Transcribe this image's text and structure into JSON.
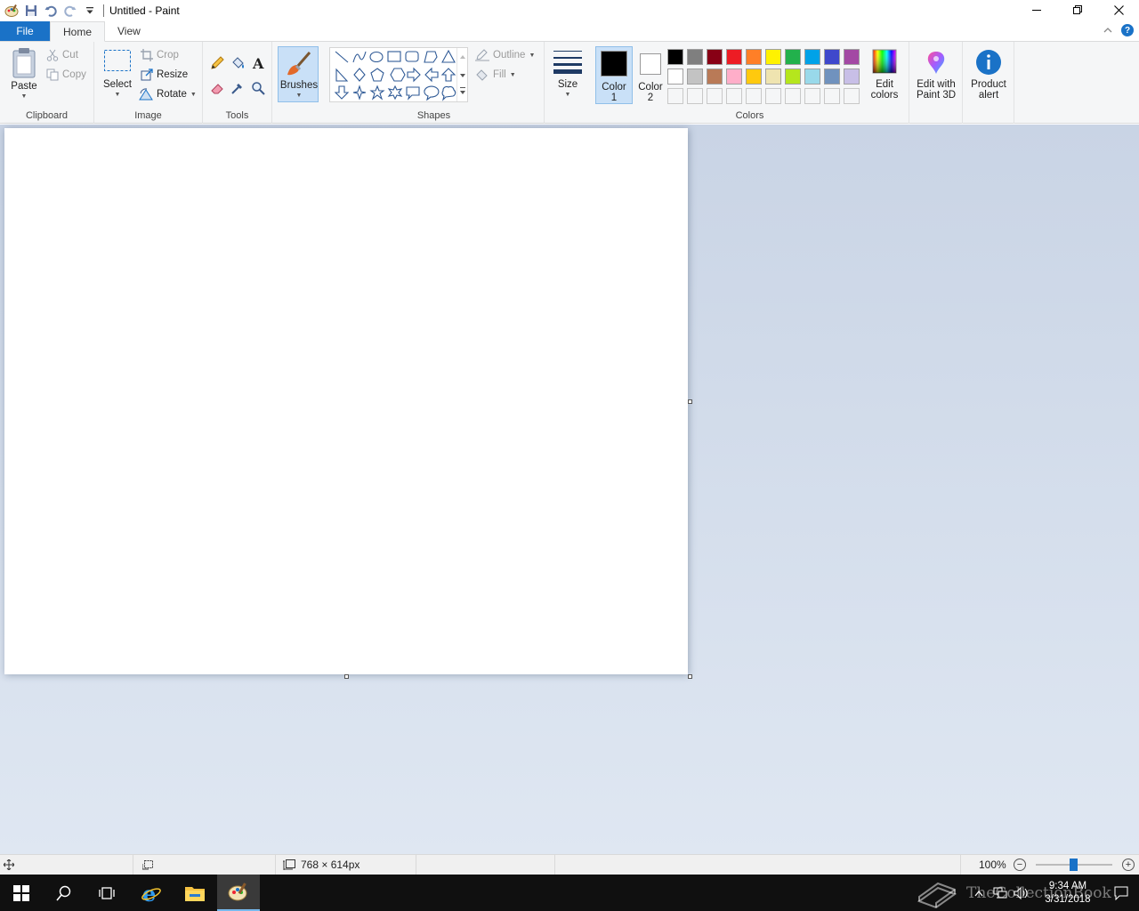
{
  "window": {
    "title": "Untitled - Paint",
    "qat_dropdown_icon": "customize-quick-access-icon"
  },
  "tabs": {
    "file": "File",
    "home": "Home",
    "view": "View",
    "help": "?"
  },
  "clipboard": {
    "label": "Clipboard",
    "paste": "Paste",
    "cut": "Cut",
    "copy": "Copy"
  },
  "image": {
    "label": "Image",
    "select": "Select",
    "crop": "Crop",
    "resize": "Resize",
    "rotate": "Rotate"
  },
  "tools": {
    "label": "Tools",
    "items": [
      "pencil-icon",
      "fill-bucket-icon",
      "text-icon",
      "eraser-icon",
      "color-picker-icon",
      "magnifier-icon"
    ]
  },
  "brushes": {
    "label": "Brushes"
  },
  "shapes": {
    "label": "Shapes",
    "outline": "Outline",
    "fill": "Fill"
  },
  "size": {
    "label": "Size"
  },
  "colors": {
    "label": "Colors",
    "color1_line1": "Color",
    "color1_line2": "1",
    "color2_line1": "Color",
    "color2_line2": "2",
    "color1_value": "#000000",
    "color2_value": "#ffffff",
    "edit_line1": "Edit",
    "edit_line2": "colors",
    "palette_row1": [
      "#000000",
      "#7f7f7f",
      "#880015",
      "#ed1c24",
      "#ff7f27",
      "#fff200",
      "#22b14c",
      "#00a2e8",
      "#3f48cc",
      "#a349a4"
    ],
    "palette_row2": [
      "#ffffff",
      "#c3c3c3",
      "#b97a57",
      "#ffaec9",
      "#ffc90e",
      "#efe4b0",
      "#b5e61d",
      "#99d9ea",
      "#7092be",
      "#c8bfe7"
    ],
    "palette_row3": [
      "#f5f6f7",
      "#f5f6f7",
      "#f5f6f7",
      "#f5f6f7",
      "#f5f6f7",
      "#f5f6f7",
      "#f5f6f7",
      "#f5f6f7",
      "#f5f6f7",
      "#f5f6f7"
    ]
  },
  "paint3d": {
    "line1": "Edit with",
    "line2": "Paint 3D"
  },
  "product_alert": {
    "line1": "Product",
    "line2": "alert"
  },
  "status": {
    "canvas_size": "768 × 614px",
    "zoom": "100%",
    "zoom_level": 1.0
  },
  "taskbar": {
    "time": "9:34 AM",
    "date": "3/31/2018",
    "watermark": "TheCollectionBook"
  }
}
